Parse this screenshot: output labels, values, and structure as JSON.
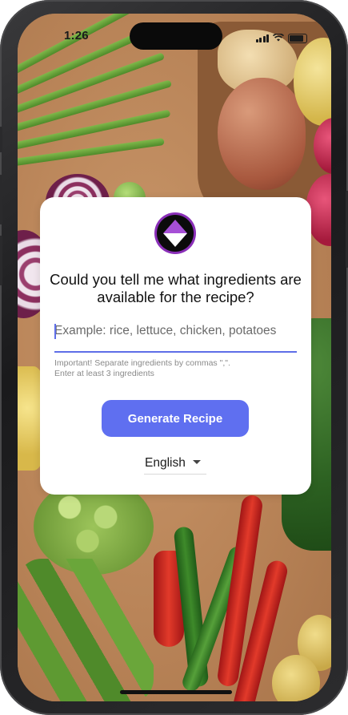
{
  "status_bar": {
    "time": "1:26"
  },
  "card": {
    "logo_icon": "app-logo-diamond-icon",
    "question": "Could you tell me what ingredients are available for the recipe?",
    "ingredients_input": {
      "value": "",
      "placeholder": "Example: rice, lettuce, chicken, potatoes"
    },
    "hint_line1": "Important! Separate ingredients by commas \",\".",
    "hint_line2": "Enter at least 3 ingredients",
    "generate_button_label": "Generate Recipe",
    "language": {
      "selected": "English"
    }
  },
  "colors": {
    "accent": "#5f6ff0",
    "logo_purple": "#9b3fc6",
    "logo_ring": "#7e2da8"
  }
}
